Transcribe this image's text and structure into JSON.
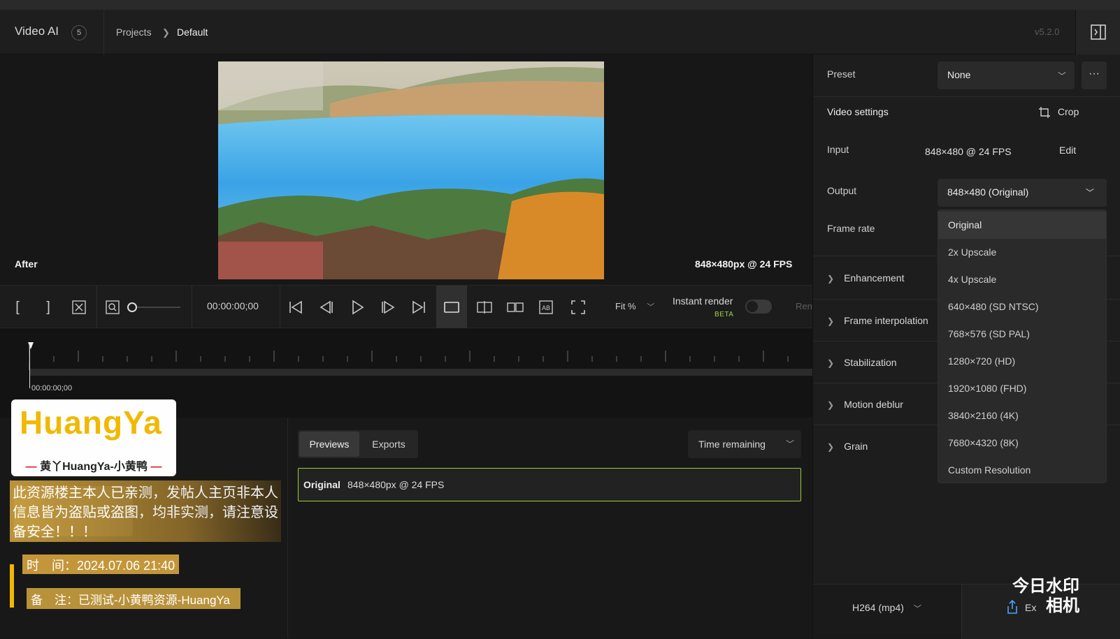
{
  "header": {
    "app_title": "Video AI",
    "badge": "5",
    "breadcrumb": [
      "Projects",
      "Default"
    ],
    "version": "v5.2.0"
  },
  "viewer": {
    "after_label": "After",
    "resolution_label": "848×480px @ 24 FPS"
  },
  "toolbar": {
    "timecode": "00:00:00;00",
    "fit_label": "Fit %",
    "instant_render_label": "Instant render",
    "beta_label": "BETA",
    "render_label": "Ren"
  },
  "timeline": {
    "timecode": "00:00:00;00"
  },
  "previews": {
    "tabs": [
      "Previews",
      "Exports"
    ],
    "time_remaining": "Time remaining",
    "row_label": "Original",
    "row_value": "848×480px @ 24 FPS"
  },
  "right_panel": {
    "preset_label": "Preset",
    "preset_value": "None",
    "video_settings_label": "Video settings",
    "crop_label": "Crop",
    "input_label": "Input",
    "input_value": "848×480 @ 24 FPS",
    "edit_label": "Edit",
    "output_label": "Output",
    "output_value": "848×480 (Original)",
    "frame_rate_label": "Frame rate",
    "output_options": [
      "Original",
      "2x Upscale",
      "4x Upscale",
      "640×480 (SD NTSC)",
      "768×576 (SD PAL)",
      "1280×720 (HD)",
      "1920×1080 (FHD)",
      "3840×2160 (4K)",
      "7680×4320 (8K)",
      "Custom Resolution"
    ],
    "sections": [
      "Enhancement",
      "Frame interpolation",
      "Stabilization",
      "Motion deblur",
      "Grain"
    ],
    "codec": "H264 (mp4)",
    "export_label": "Ex"
  },
  "overlay": {
    "logo_text": "HuangYa",
    "logo_sub": "黄丫HuangYa-小黄鸭",
    "notice": "此资源楼主本人已亲测，发帖人主页非本人信息皆为盗贴或盗图，均非实测，请注意设备安全！！！",
    "time_line": "时　间：2024.07.06 21:40",
    "note_line": "备　注：已测试-小黄鸭资源-HuangYa",
    "stamp_line1": "今日水印",
    "stamp_line2": "相机"
  },
  "colors": {
    "accent_green": "#9ccd3c",
    "panel_bg": "#1d1d1d",
    "viewer_bg": "#171717"
  }
}
